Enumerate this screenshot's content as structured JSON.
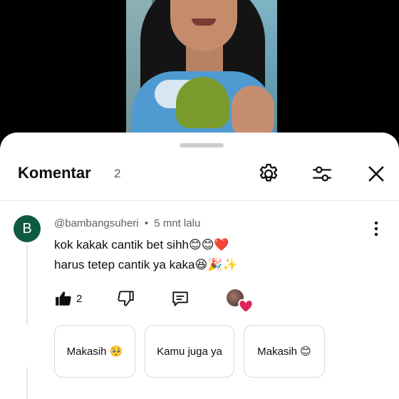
{
  "header": {
    "title": "Komentar",
    "count": "2"
  },
  "comment": {
    "avatar_letter": "B",
    "author": "@bambangsuheri",
    "separator": "•",
    "time": "5 mnt lalu",
    "line1": "kok kakak cantik bet sihh😊😊❤️",
    "line2": "harus tetep cantik ya kaka😆🎉✨",
    "like_count": "2"
  },
  "suggestions": [
    {
      "label": "Makasih 🥺"
    },
    {
      "label": "Kamu juga ya"
    },
    {
      "label": "Makasih 😊"
    }
  ],
  "icons": {
    "settings": "gear-icon",
    "filter": "sliders-icon",
    "close": "close-icon",
    "more": "more-vert-icon",
    "like": "thumb-up-icon",
    "dislike": "thumb-down-icon",
    "reply": "reply-icon",
    "creator_heart": "heart-icon"
  },
  "colors": {
    "avatar_bg": "#0f5a43",
    "heart": "#e0245e"
  }
}
